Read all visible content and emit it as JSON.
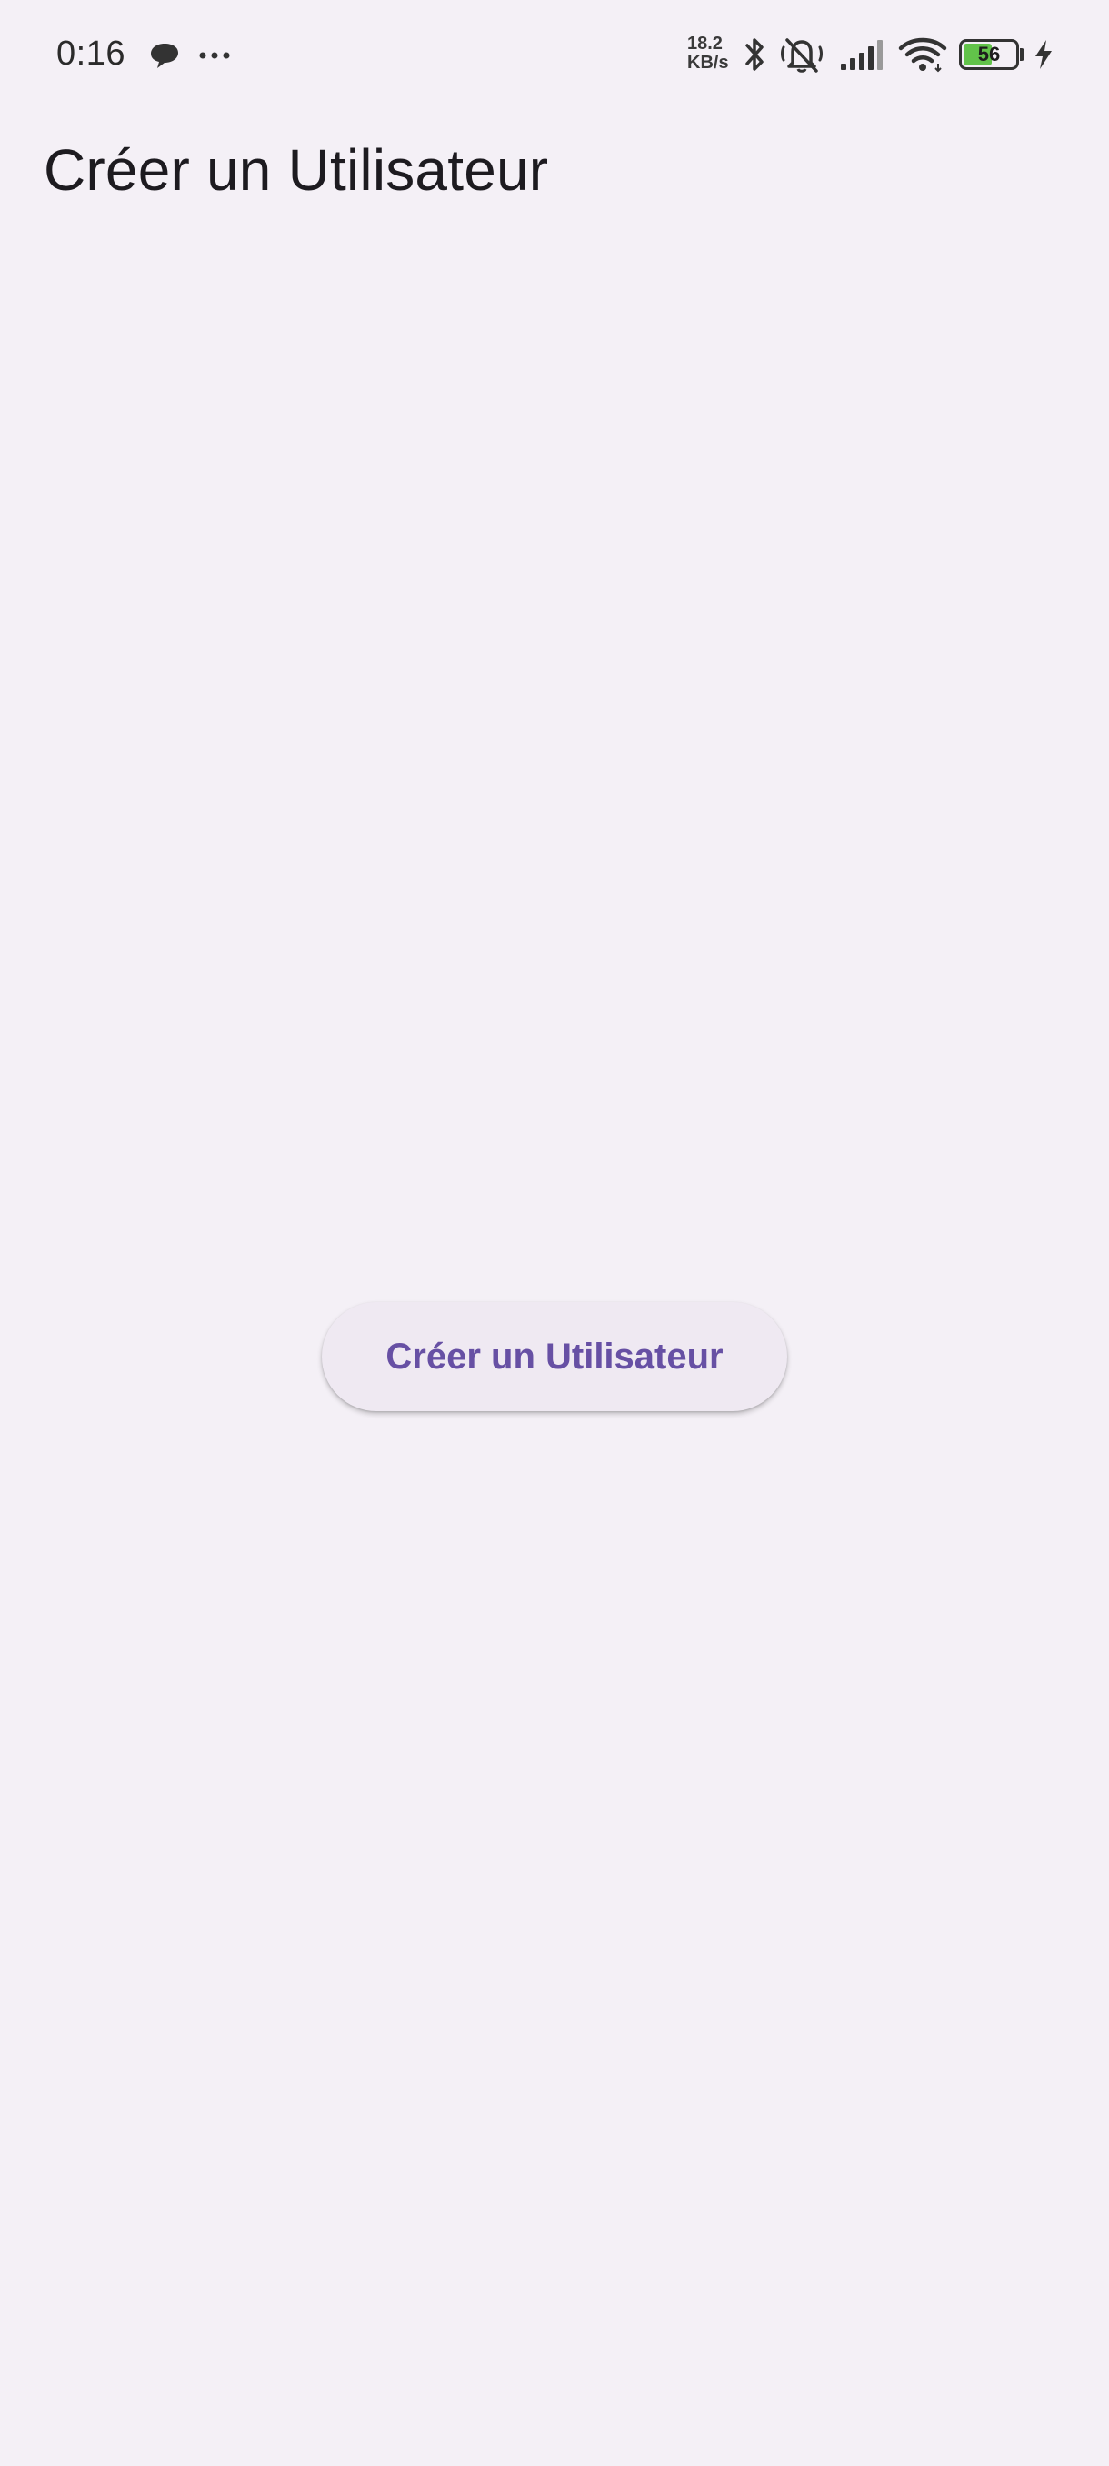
{
  "status_bar": {
    "time": "0:16",
    "net_speed_value": "18.2",
    "net_speed_unit": "KB/s",
    "battery_level": "56",
    "icons": [
      "chat-bubble-icon",
      "more-dots-icon",
      "bluetooth-icon",
      "notifications-off-icon",
      "signal-icon",
      "wifi-icon",
      "battery-icon",
      "charging-icon"
    ]
  },
  "app_bar": {
    "title": "Créer un Utilisateur"
  },
  "main": {
    "create_button_label": "Créer un Utilisateur"
  },
  "colors": {
    "background": "#f4f0f6",
    "primary": "#6750a4",
    "button_surface": "#efe9f2",
    "battery_fill": "#62c34a"
  }
}
